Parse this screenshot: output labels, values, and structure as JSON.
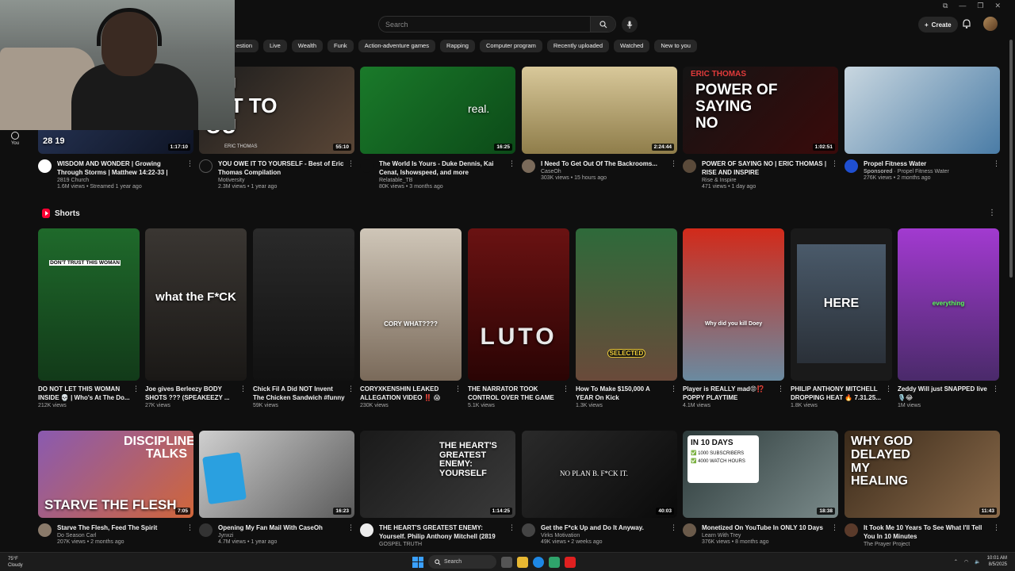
{
  "header": {
    "search_placeholder": "Search",
    "create_label": "Create"
  },
  "chips": [
    "estion",
    "Live",
    "Wealth",
    "Funk",
    "Action-adventure games",
    "Rapping",
    "Computer program",
    "Recently uploaded",
    "Watched",
    "New to you"
  ],
  "sidebar": {
    "you_label": "You"
  },
  "row1": [
    {
      "title": "WISDOM AND WONDER | Growing Through Storms | Matthew 14:22-33 | Philip Anthon...",
      "channel": "2819 Church",
      "stats": "1.6M views • Streamed 1 year ago",
      "duration": "1:17:10",
      "thumb_text": "28 19"
    },
    {
      "title": "YOU OWE IT TO YOURSELF - Best of Eric Thomas Compilation",
      "channel": "Motiversity",
      "stats": "2.3M views • 1 year ago",
      "duration": "55:10",
      "thumb_text": "OU\nE IT TO\nOU"
    },
    {
      "title": "The World Is Yours - Duke Dennis, Kai Cenat, Ishowspeed, and more",
      "channel": "Relatable_TB",
      "stats": "80K views • 3 months ago",
      "duration": "16:25",
      "thumb_text": "real."
    },
    {
      "title": "I Need To Get Out Of The Backrooms...",
      "channel": "CaseOh",
      "stats": "303K views • 15 hours ago",
      "duration": "2:24:44",
      "thumb_text": ""
    },
    {
      "title": "POWER OF SAYING NO | ERIC THOMAS | RISE AND INSPIRE",
      "channel": "Rise & Inspire",
      "stats": "471 views • 1 day ago",
      "duration": "1:02:51",
      "thumb_text": "POWER OF\nSAYING\nNO"
    },
    {
      "title": "Propel Fitness Water",
      "channel": "Propel Fitness Water",
      "sponsored": "Sponsored",
      "stats": "276K views • 2 months ago",
      "duration": "",
      "thumb_text": ""
    }
  ],
  "shorts": {
    "label": "Shorts",
    "items": [
      {
        "title": "DO NOT LET THIS WOMAN INSIDE 💀 | Who's At The Do...",
        "views": "212K views",
        "thumb_text": "DON'T TRUST THIS WOMAN"
      },
      {
        "title": "Joe gives Berleezy BODY SHOTS ??? (SPEAKEEZY ...",
        "views": "27K views",
        "thumb_text": "what the F*CK"
      },
      {
        "title": "Chick Fil A Did NOT Invent The Chicken Sandwich #funny ...",
        "views": "59K views",
        "thumb_text": ""
      },
      {
        "title": "CORYXKENSHIN LEAKED ALLEGATION VIDEO ‼️ 😱",
        "views": "230K views",
        "thumb_text": "CORY WHAT????"
      },
      {
        "title": "THE NARRATOR TOOK CONTROL OVER THE GAME |...",
        "views": "5.1K views",
        "thumb_text": "LUTO"
      },
      {
        "title": "How To Make $150,000 A YEAR On Kick",
        "views": "1.3K views",
        "thumb_text": "SELECTED"
      },
      {
        "title": "Player is REALLY mad😡⁉️ POPPY PLAYTIME CHAPTER...",
        "views": "4.1M views",
        "thumb_text": "Why did you kill Doey"
      },
      {
        "title": "PHILIP ANTHONY MITCHELL DROPPING HEAT 🔥 7.31.25...",
        "views": "1.8K views",
        "thumb_text": "HERE"
      },
      {
        "title": "Zeddy Will just SNAPPED live 🎙️😂",
        "views": "1M views",
        "thumb_text": "everything"
      }
    ]
  },
  "row3": [
    {
      "title": "Starve The Flesh, Feed The Spirit",
      "channel": "Do Season Carl",
      "stats": "207K views • 2 months ago",
      "duration": "7:05",
      "thumb_text": "STARVE THE FLESH"
    },
    {
      "title": "Opening My Fan Mail With CaseOh",
      "channel": "Jynxzi",
      "stats": "4.7M views • 1 year ago",
      "duration": "16:23",
      "thumb_text": ""
    },
    {
      "title": "THE HEART'S GREATEST ENEMY: Yourself. Philip Anthony Mitchell (2819 Church)",
      "channel": "GOSPEL TRUTH",
      "stats": "",
      "duration": "1:14:25",
      "thumb_text": "THE HEART'S GREATEST ENEMY: YOURSELF"
    },
    {
      "title": "Get the F*ck Up and Do It Anyway.",
      "channel": "Virks Motivation",
      "stats": "49K views • 2 weeks ago",
      "duration": "40:03",
      "thumb_text": "NO PLAN B. F*CK IT."
    },
    {
      "title": "Monetized On YouTube In ONLY 10 Days",
      "channel": "Learn With Trey",
      "stats": "376K views • 8 months ago",
      "duration": "18:38",
      "thumb_text": "IN 10 DAYS"
    },
    {
      "title": "It Took Me 10 Years To See What I'll Tell You In 10 Minutes",
      "channel": "The Prayer Project",
      "stats": "",
      "duration": "11:43",
      "thumb_text": "WHY GOD DELAYED MY HEALING"
    }
  ],
  "row3_badges": [
    "1000 SUBSCRIBERS",
    "4000 WATCH HOURS"
  ],
  "row3_extra": {
    "discipline": "DISCIPLINE TALKS"
  },
  "row1_extra": {
    "eric": "ERIC THOMAS"
  },
  "taskbar": {
    "temp": "75°F",
    "weather": "Cloudy",
    "search_label": "Search",
    "time": "10:01 AM",
    "date": "8/5/2025"
  },
  "colors": {
    "bg": "#0f0f0f",
    "chip": "#272727",
    "accent": "#ff0033"
  }
}
